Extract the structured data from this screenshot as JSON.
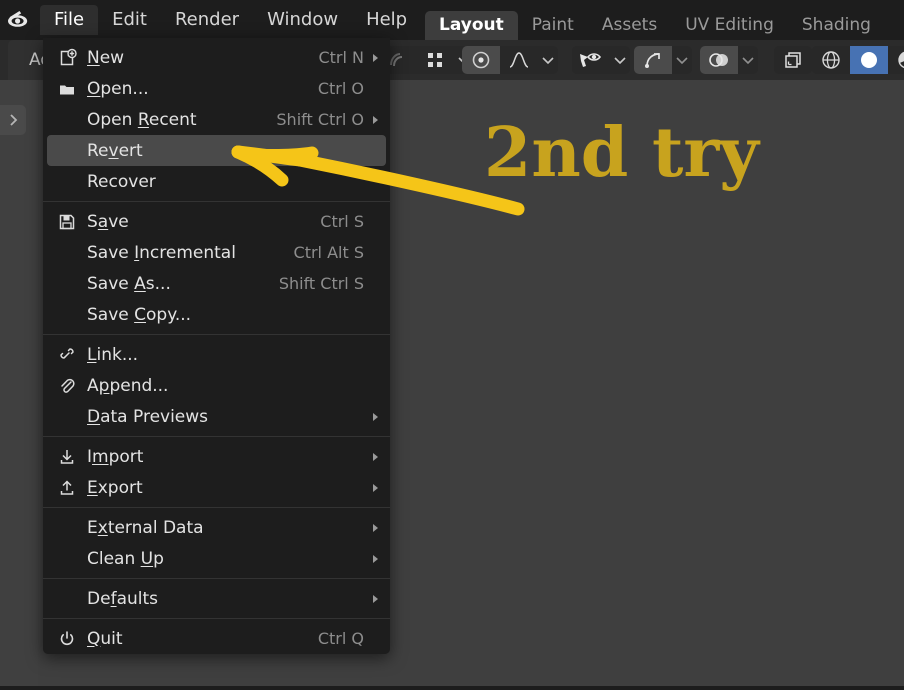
{
  "app": {
    "name": "Blender",
    "logo_icon": "blender-logo-icon"
  },
  "menubar": {
    "items": [
      {
        "label": "File",
        "active": true
      },
      {
        "label": "Edit",
        "active": false
      },
      {
        "label": "Render",
        "active": false
      },
      {
        "label": "Window",
        "active": false
      },
      {
        "label": "Help",
        "active": false
      }
    ]
  },
  "workspace_tabs": {
    "items": [
      {
        "label": "Layout",
        "active": true
      },
      {
        "label": "Paint",
        "active": false
      },
      {
        "label": "Assets",
        "active": false
      },
      {
        "label": "UV Editing",
        "active": false
      },
      {
        "label": "Shading",
        "active": false
      }
    ]
  },
  "toolheader": {
    "editor_tab_label": "Ad",
    "groups": [
      {
        "name": "proportional-editing-group",
        "icons": [
          "proportional-edit-icon",
          "snap-grid-icon",
          "chevron-down-icon"
        ]
      },
      {
        "name": "snapping-group",
        "icons": [
          "snap-magnet-icon",
          "falloff-curve-icon",
          "chevron-down-icon"
        ]
      },
      {
        "name": "visibility-group",
        "icons": [
          "select-visibility-icon",
          "chevron-down-icon"
        ]
      },
      {
        "name": "transform-group",
        "icons": [
          "transform-orientation-icon",
          "chevron-down-icon"
        ]
      },
      {
        "name": "overlays-group",
        "icons": [
          "overlay-toggle-icon",
          "chevron-down-icon"
        ]
      },
      {
        "name": "xray-group",
        "icons": [
          "xray-toggle-icon"
        ]
      },
      {
        "name": "shading-group",
        "icons": [
          "wireframe-shading-icon",
          "solid-shading-icon",
          "material-preview-icon"
        ]
      }
    ]
  },
  "viewport": {
    "expand_icon": "chevron-right-icon",
    "background_color": "#3f3f3f"
  },
  "file_menu": {
    "sections": [
      {
        "items": [
          {
            "icon": "new-file-icon",
            "label": "New",
            "underline_index": 0,
            "shortcut": "Ctrl N",
            "submenu": true
          },
          {
            "icon": "open-folder-icon",
            "label": "Open...",
            "underline_index": 0,
            "shortcut": "Ctrl O",
            "submenu": false
          },
          {
            "icon": null,
            "label": "Open Recent",
            "underline_index": 5,
            "shortcut": "Shift Ctrl O",
            "submenu": true
          },
          {
            "icon": null,
            "label": "Revert",
            "underline_index": 3,
            "shortcut": "",
            "submenu": false,
            "highlighted": true
          },
          {
            "icon": null,
            "label": "Recover",
            "underline_index": -1,
            "shortcut": "",
            "submenu": false
          }
        ]
      },
      {
        "items": [
          {
            "icon": "save-floppy-icon",
            "label": "Save",
            "underline_index": 1,
            "shortcut": "Ctrl S",
            "submenu": false
          },
          {
            "icon": null,
            "label": "Save Incremental",
            "underline_index": 5,
            "shortcut": "Ctrl Alt S",
            "submenu": false
          },
          {
            "icon": null,
            "label": "Save As...",
            "underline_index": 5,
            "shortcut": "Shift Ctrl S",
            "submenu": false
          },
          {
            "icon": null,
            "label": "Save Copy...",
            "underline_index": 5,
            "shortcut": "",
            "submenu": false
          }
        ]
      },
      {
        "items": [
          {
            "icon": "chain-link-icon",
            "label": "Link...",
            "underline_index": 0,
            "shortcut": "",
            "submenu": false
          },
          {
            "icon": "paperclip-icon",
            "label": "Append...",
            "underline_index": 1,
            "shortcut": "",
            "submenu": false
          },
          {
            "icon": null,
            "label": "Data Previews",
            "underline_index": 0,
            "shortcut": "",
            "submenu": true
          }
        ]
      },
      {
        "items": [
          {
            "icon": "import-arrow-icon",
            "label": "Import",
            "underline_index": 1,
            "shortcut": "",
            "submenu": true
          },
          {
            "icon": "export-arrow-icon",
            "label": "Export",
            "underline_index": 0,
            "shortcut": "",
            "submenu": true
          }
        ]
      },
      {
        "items": [
          {
            "icon": null,
            "label": "External Data",
            "underline_index": 1,
            "shortcut": "",
            "submenu": true
          },
          {
            "icon": null,
            "label": "Clean Up",
            "underline_index": 6,
            "shortcut": "",
            "submenu": true
          }
        ]
      },
      {
        "items": [
          {
            "icon": null,
            "label": "Defaults",
            "underline_index": 3,
            "shortcut": "",
            "submenu": true
          }
        ]
      },
      {
        "items": [
          {
            "icon": "power-icon",
            "label": "Quit",
            "underline_index": 0,
            "shortcut": "Ctrl Q",
            "submenu": false
          }
        ]
      }
    ]
  },
  "annotation": {
    "text": "2nd try",
    "color": "#c8a31e",
    "arrow_color": "#f5c518",
    "arrow_points_to": "Revert"
  }
}
